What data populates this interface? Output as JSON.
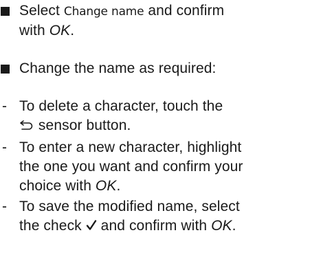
{
  "steps": [
    {
      "marker": "square",
      "parts": {
        "select": "Select ",
        "ui_name": "Change name",
        "and_confirm": " and confirm",
        "with": "with ",
        "ok": "OK",
        "end": "."
      }
    },
    {
      "marker": "square",
      "parts": {
        "text": "Change the name as required:"
      }
    },
    {
      "marker": "-",
      "parts": {
        "line1": "To delete a character, touch the",
        "icon": "back-arrow-icon",
        "line2_rest": " sensor button."
      }
    },
    {
      "marker": "-",
      "parts": {
        "line1": "To enter a new character, highlight",
        "line2": "the one you want and confirm your",
        "line3_start": "choice with ",
        "ok": "OK",
        "end": "."
      }
    },
    {
      "marker": "-",
      "parts": {
        "line1": "To save the modified name, select",
        "line2_start": "the check ",
        "icon": "check-icon",
        "line2_mid": " and confirm with ",
        "ok": "OK",
        "end": "."
      }
    }
  ]
}
